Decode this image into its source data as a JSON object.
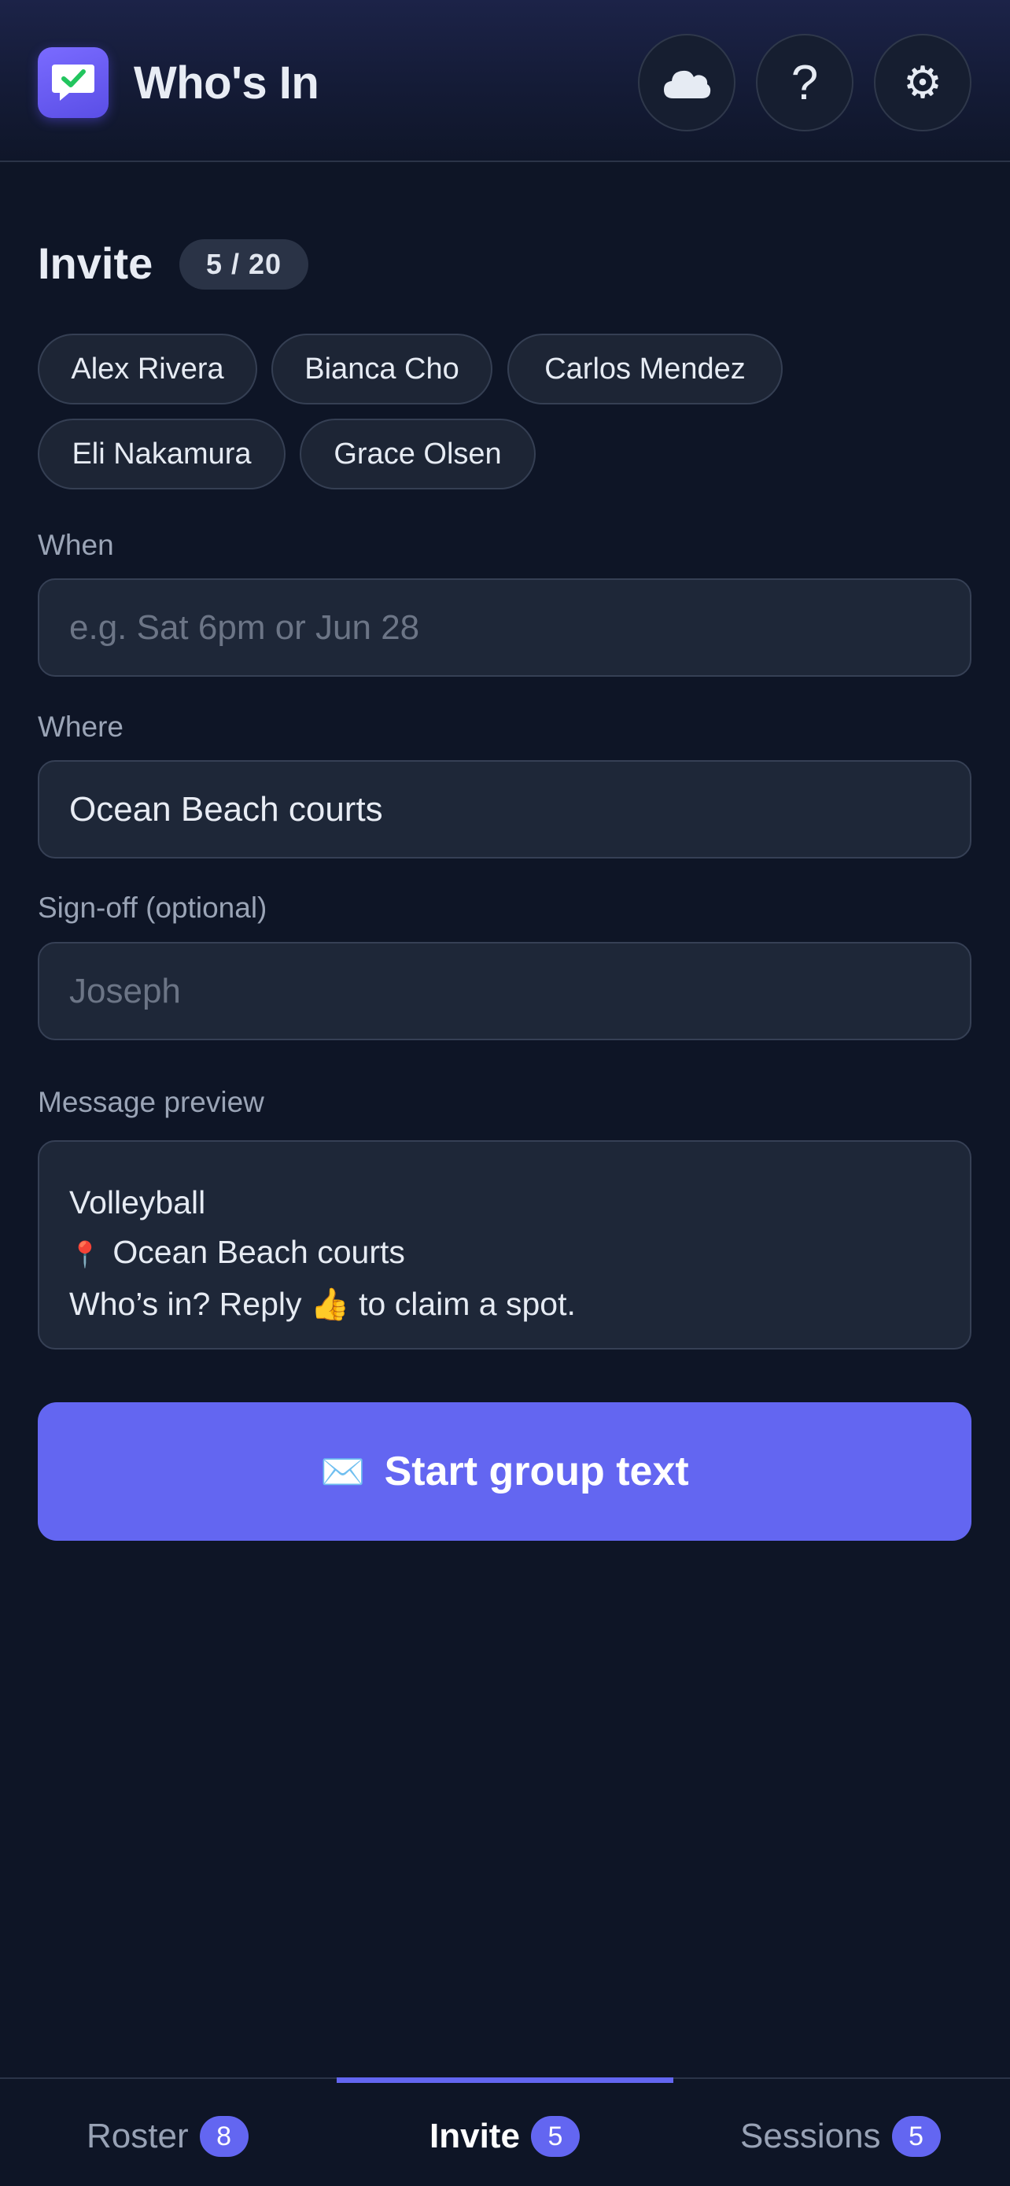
{
  "header": {
    "app_title": "Who's In",
    "buttons": [
      {
        "name": "cloud-sync",
        "icon": "cloud-icon"
      },
      {
        "name": "help",
        "icon": "question-icon",
        "glyph": "?"
      },
      {
        "name": "settings",
        "icon": "gear-icon",
        "glyph": "⚙"
      }
    ]
  },
  "invite": {
    "title": "Invite",
    "count": "5 / 20",
    "selected": [
      "Alex Rivera",
      "Bianca Cho",
      "Carlos Mendez",
      "Eli Nakamura",
      "Grace Olsen"
    ]
  },
  "form": {
    "when": {
      "label": "When",
      "value": "",
      "placeholder": "e.g. Sat 6pm or Jun 28"
    },
    "where": {
      "label": "Where",
      "value": "Ocean Beach courts",
      "placeholder": ""
    },
    "signoff": {
      "label": "Sign-off (optional)",
      "value": "",
      "placeholder": "Joseph"
    }
  },
  "preview": {
    "label": "Message preview",
    "line1": "Volleyball",
    "line2_icon": "📍",
    "line2": "Ocean Beach courts",
    "line3_before": "Who’s in? Reply",
    "line3_emoji": "👍",
    "line3_after": "to claim a spot."
  },
  "cta": {
    "icon": "✉️",
    "label": "Start group text"
  },
  "tabs": [
    {
      "label": "Roster",
      "badge": "8",
      "active": false
    },
    {
      "label": "Invite",
      "badge": "5",
      "active": true
    },
    {
      "label": "Sessions",
      "badge": "5",
      "active": false
    }
  ],
  "colors": {
    "accent": "#6366f1",
    "background": "#0e1526",
    "field": "#1e2738",
    "check": "#22c55e"
  }
}
